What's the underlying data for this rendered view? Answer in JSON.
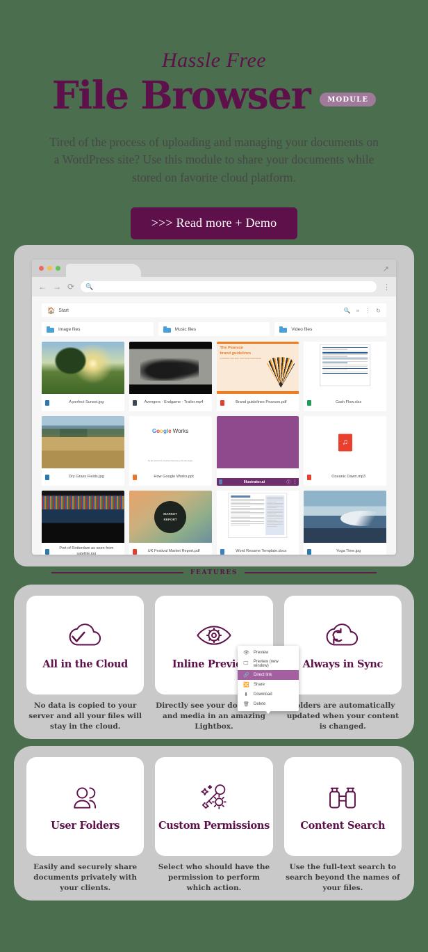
{
  "hero": {
    "eyebrow": "Hassle Free",
    "title": "File Browser",
    "badge": "MODULE",
    "subtitle": "Tired of the process of uploading and managing your documents on a WordPress site? Use this module to share your documents while stored on favorite cloud platform.",
    "cta": ">>> Read more + Demo"
  },
  "browser": {
    "url_placeholder": "",
    "filebrowser": {
      "breadcrumb": "Start",
      "toolbar_icons": [
        "search-icon",
        "sort-icon",
        "more-icon",
        "refresh-icon"
      ],
      "folders": [
        {
          "name": "Image files"
        },
        {
          "name": "Music files"
        },
        {
          "name": "Video files"
        }
      ],
      "files": [
        {
          "name": "A perfect Sunset.jpg",
          "type": "image",
          "art": "sunset"
        },
        {
          "name": "Avengers - Endgame - Trailer.mp4",
          "type": "video",
          "art": "avengers"
        },
        {
          "name": "Brand guidelines Pearson.pdf",
          "type": "pdf",
          "art": "pearson",
          "art_title": "The Pearson\nbrand guidelines",
          "art_sub": "A refreshed, more open, more human brand identity"
        },
        {
          "name": "Cash Flow.xlsx",
          "type": "xls",
          "art": "doc"
        },
        {
          "name": "Dry Grass Fields.jpg",
          "type": "image",
          "art": "grass"
        },
        {
          "name": "How Google Works.ppt",
          "type": "ppt",
          "art": "google",
          "art_words": [
            "G",
            "o",
            "o",
            "g",
            "l",
            "e"
          ],
          "art_suffix": "Works",
          "art_sub": "By Eric Schmidt & Jonathan Rosenberg with Alan Eagle"
        },
        {
          "name": "Illustrator.ai",
          "type": "ai",
          "art": "purple",
          "selected": true
        },
        {
          "name": "Oceanic Dawn.mp3",
          "type": "pdf",
          "art": "mp3"
        },
        {
          "name": "Port of Rotterdam as seen from satellite.jpg",
          "type": "image",
          "art": "port"
        },
        {
          "name": "UK Festival Market Report.pdf",
          "type": "pdf",
          "art": "market"
        },
        {
          "name": "Word Resume Template.docx",
          "type": "doc",
          "art": "resume"
        },
        {
          "name": "Yoga Time.jpg",
          "type": "image",
          "art": "yoga"
        }
      ],
      "context_menu": [
        {
          "label": "Preview",
          "icon": "eye-icon",
          "active": false
        },
        {
          "label": "Preview (new window)",
          "icon": "monitor-icon",
          "active": false
        },
        {
          "label": "Direct link",
          "icon": "link-icon",
          "active": true
        },
        {
          "label": "Share",
          "icon": "share-icon",
          "active": false
        },
        {
          "label": "Download",
          "icon": "download-icon",
          "active": false
        },
        {
          "label": "Delete",
          "icon": "trash-icon",
          "active": false
        }
      ]
    }
  },
  "features": {
    "label": "FEATURES",
    "row1": [
      {
        "title": "All in the Cloud",
        "icon": "cloud-check-icon",
        "desc": "No data is copied to your server and all your files will stay in the cloud."
      },
      {
        "title": "Inline Previews",
        "icon": "eye-preview-icon",
        "desc": "Directly see your documents and media in an amazing Lightbox."
      },
      {
        "title": "Always in Sync",
        "icon": "cloud-sync-icon",
        "desc": "Folders are automatically updated when your content is changed."
      }
    ],
    "row2": [
      {
        "title": "User Folders",
        "icon": "users-icon",
        "desc": "Easily and securely share documents privately with your clients."
      },
      {
        "title": "Custom Permissions",
        "icon": "key-gear-icon",
        "desc": "Select who should have the permission to perform which action."
      },
      {
        "title": "Content Search",
        "icon": "binoculars-icon",
        "desc": "Use the full-text search to search beyond the names of your files."
      }
    ]
  },
  "colors": {
    "background": "#4a6e4e",
    "accent": "#5d1049",
    "badge": "#a07a9b",
    "panel": "#c9c9c9"
  }
}
